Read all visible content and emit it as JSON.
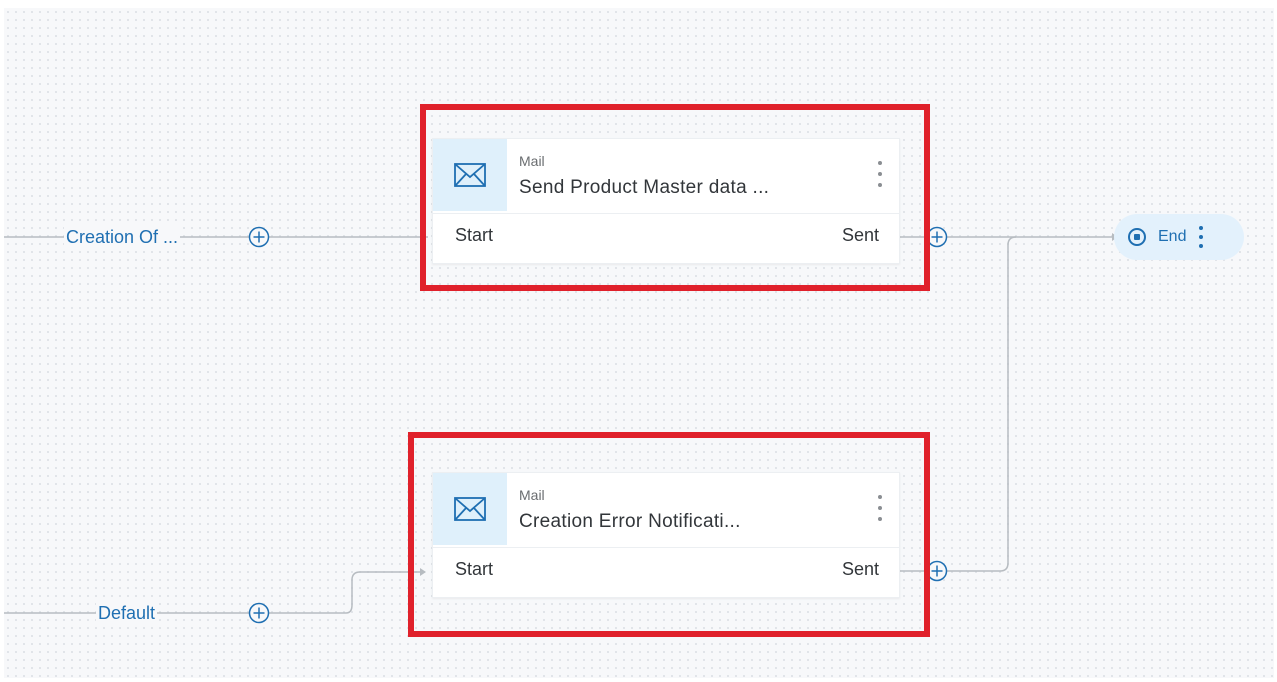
{
  "branches": [
    {
      "label": "Creation Of ..."
    },
    {
      "label": "Default"
    }
  ],
  "nodes": [
    {
      "type": "Mail",
      "title": "Send Product Master data ...",
      "input_port": "Start",
      "output_port": "Sent",
      "icon": "mail-icon"
    },
    {
      "type": "Mail",
      "title": "Creation Error Notificati...",
      "input_port": "Start",
      "output_port": "Sent",
      "icon": "mail-icon"
    }
  ],
  "end_node": {
    "label": "End",
    "icon": "stop-circle-icon"
  },
  "colors": {
    "accent": "#1f6fb2",
    "highlight": "#e0212b",
    "icon_bg": "#dff0fb",
    "end_bg": "#e3f1fc",
    "connector": "#b7bcc1"
  }
}
